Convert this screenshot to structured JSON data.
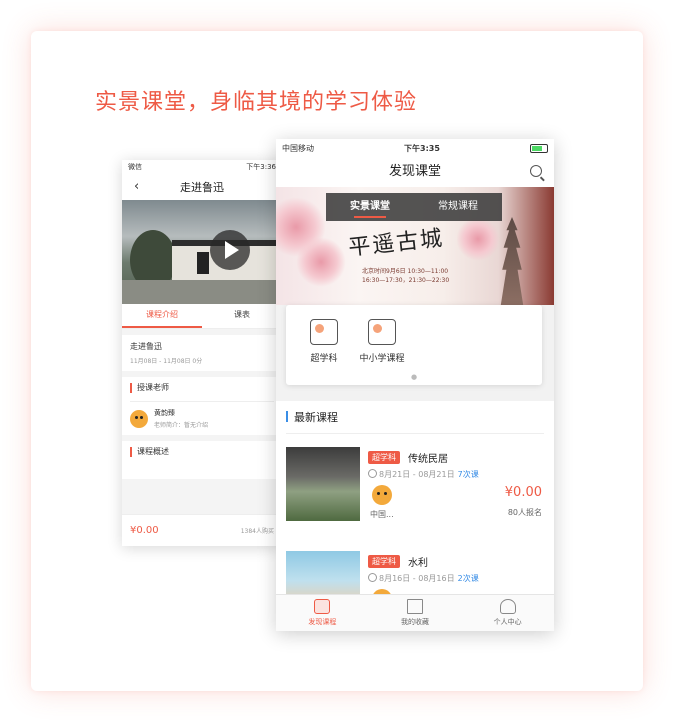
{
  "headline": "实景课堂，身临其境的学习体验",
  "colors": {
    "accent": "#ee5a45",
    "link": "#3a8ee6"
  },
  "left_phone": {
    "status": {
      "carrier": "微信",
      "time": "下午3:36"
    },
    "nav": {
      "title": "走进鲁迅"
    },
    "tabs": [
      {
        "label": "课程介绍",
        "active": true
      },
      {
        "label": "课表",
        "active": false
      }
    ],
    "course": {
      "name": "走进鲁迅",
      "date": "11月08日 - 11月08日 0分"
    },
    "teacher_section": {
      "header": "授课老师",
      "name": "黄韵臻",
      "intro": "老师简介：暂无介绍"
    },
    "overview_section": {
      "header": "课程概述"
    },
    "footer": {
      "price": "¥0.00",
      "buyers": "1384人购买"
    }
  },
  "right_phone": {
    "status": {
      "carrier": "中国移动",
      "time": "下午3:35"
    },
    "nav": {
      "title": "发现课堂"
    },
    "segment": [
      {
        "label": "实景课堂",
        "active": true
      },
      {
        "label": "常规课程",
        "active": false
      }
    ],
    "banner": {
      "calligraphy": "平遥古城",
      "info_line1": "北京时间9月6日 10:30—11:00",
      "info_line2": "16:30—17:30，21:30—22:30"
    },
    "categories": [
      {
        "label": "超学科",
        "icon": "head-bulb-icon"
      },
      {
        "label": "中小学课程",
        "icon": "books-icon"
      }
    ],
    "page_indicator": "●",
    "new_section": {
      "title": "最新课程"
    },
    "courses": [
      {
        "tag": "超学科",
        "title": "传统民居",
        "date": "8月21日 - 08月21日",
        "times": "7次课",
        "school": "中国...",
        "price": "¥0.00",
        "enrolled": "80人报名"
      },
      {
        "tag": "超学科",
        "title": "水利",
        "date": "8月16日 - 08月16日",
        "times": "2次课"
      }
    ],
    "tabbar": [
      {
        "label": "发现课程",
        "active": true,
        "icon": "play-card-icon"
      },
      {
        "label": "我的收藏",
        "active": false,
        "icon": "book-icon"
      },
      {
        "label": "个人中心",
        "active": false,
        "icon": "person-icon"
      }
    ]
  }
}
